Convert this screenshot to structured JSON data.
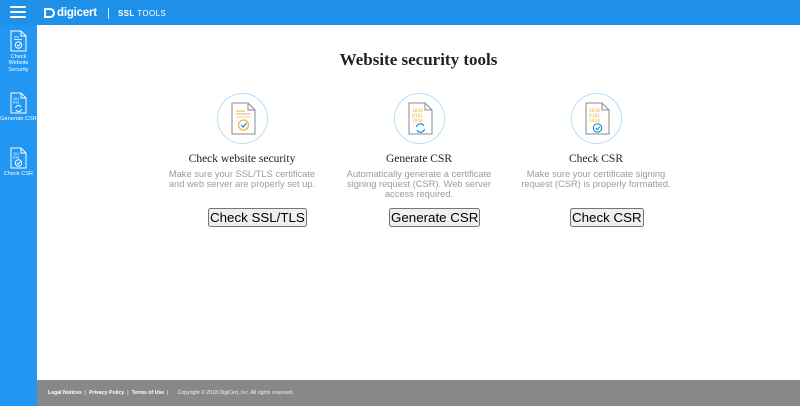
{
  "header": {
    "brand_name": "digicert",
    "app_title_bold": "SSL",
    "app_title": "TOOLS"
  },
  "sidebar": {
    "items": [
      {
        "label": "Check Website Security",
        "icon": "certificate-icon"
      },
      {
        "label": "Generate CSR",
        "icon": "csr-refresh-icon"
      },
      {
        "label": "Check CSR",
        "icon": "csr-check-icon"
      }
    ]
  },
  "main": {
    "title": "Website security tools",
    "cards": [
      {
        "heading": "Check website security",
        "description": "Make sure your SSL/TLS certificate and web server are properly set up.",
        "button": "Check SSL/TLS",
        "icon": "certificate-badge-icon"
      },
      {
        "heading": "Generate CSR",
        "description": "Automatically generate a certificate signing request (CSR). Web server access required.",
        "button": "Generate CSR",
        "icon": "csr-refresh-icon"
      },
      {
        "heading": "Check CSR",
        "description": "Make sure your certificate signing request (CSR) is properly formatted.",
        "button": "Check CSR",
        "icon": "csr-check-icon"
      }
    ]
  },
  "footer": {
    "links": [
      "Legal Notices",
      "Privacy Policy",
      "Terms of Use"
    ],
    "copyright": "Copyright © 2018 DigiCert, Inc. All rights reserved."
  },
  "colors": {
    "topbar": "#1e90e8",
    "sidebar": "#2196f3",
    "button": "#1a8fe3",
    "footer": "#888888",
    "icon_accent": "#f0b23a"
  }
}
